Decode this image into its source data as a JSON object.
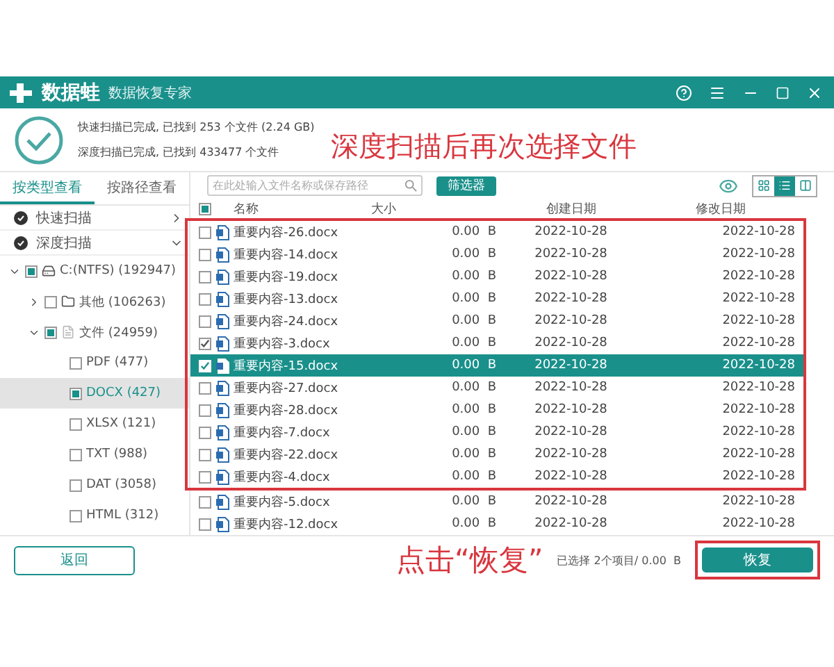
{
  "app": {
    "name": "数据蛙",
    "subtitle": "数据恢复专家"
  },
  "scan_status": [
    "快速扫描已完成, 已找到 253 个文件 (2.24 GB)",
    "深度扫描已完成, 已找到 433477 个文件"
  ],
  "annotations": [
    "深度扫描后再次选择文件",
    "点击“恢复”"
  ],
  "view_tabs": [
    {
      "label": "按类型查看",
      "selected": true
    },
    {
      "label": "按路径查看",
      "selected": false
    }
  ],
  "scan_modes": [
    {
      "label": "快速扫描",
      "expanded": false
    },
    {
      "label": "深度扫描",
      "expanded": true
    }
  ],
  "tree": [
    {
      "label": "C:(NTFS) (192947)",
      "kind": "drive",
      "checked": true,
      "partial": true,
      "expanded": true,
      "selected": false,
      "children": [
        {
          "label": "其他 (106263)",
          "kind": "folder",
          "checked": false,
          "partial": false,
          "expanded": false,
          "selected": false
        },
        {
          "label": "文件 (24959)",
          "kind": "category",
          "checked": true,
          "partial": true,
          "expanded": true,
          "selected": false,
          "children": [
            {
              "label": "PDF (477)",
              "kind": "type",
              "checked": false,
              "partial": false,
              "selected": false
            },
            {
              "label": "DOCX (427)",
              "kind": "type",
              "checked": true,
              "partial": true,
              "selected": true
            },
            {
              "label": "XLSX (121)",
              "kind": "type",
              "checked": false,
              "partial": false,
              "selected": false
            },
            {
              "label": "TXT (988)",
              "kind": "type",
              "checked": false,
              "partial": false,
              "selected": false
            },
            {
              "label": "DAT (3058)",
              "kind": "type",
              "checked": false,
              "partial": false,
              "selected": false
            },
            {
              "label": "HTML (312)",
              "kind": "type",
              "checked": false,
              "partial": false,
              "selected": false
            }
          ]
        }
      ]
    }
  ],
  "search": {
    "placeholder": "在此处输入文件名称或保存路径"
  },
  "filter_button": "筛选器",
  "view_modes": [
    {
      "kind": "grid",
      "selected": false
    },
    {
      "kind": "list",
      "selected": true
    },
    {
      "kind": "detail",
      "selected": false
    }
  ],
  "table": {
    "header_checked": true,
    "header_partial": true,
    "columns": [
      "名称",
      "大小",
      "创建日期",
      "修改日期"
    ],
    "framed_rows": [
      {
        "name": "重要内容-26.docx",
        "size": "0.00  B",
        "created": "2022-10-28",
        "modified": "2022-10-28",
        "checked": false,
        "selected": false
      },
      {
        "name": "重要内容-14.docx",
        "size": "0.00  B",
        "created": "2022-10-28",
        "modified": "2022-10-28",
        "checked": false,
        "selected": false
      },
      {
        "name": "重要内容-19.docx",
        "size": "0.00  B",
        "created": "2022-10-28",
        "modified": "2022-10-28",
        "checked": false,
        "selected": false
      },
      {
        "name": "重要内容-13.docx",
        "size": "0.00  B",
        "created": "2022-10-28",
        "modified": "2022-10-28",
        "checked": false,
        "selected": false
      },
      {
        "name": "重要内容-24.docx",
        "size": "0.00  B",
        "created": "2022-10-28",
        "modified": "2022-10-28",
        "checked": false,
        "selected": false
      },
      {
        "name": "重要内容-3.docx",
        "size": "0.00  B",
        "created": "2022-10-28",
        "modified": "2022-10-28",
        "checked": true,
        "selected": false
      },
      {
        "name": "重要内容-15.docx",
        "size": "0.00  B",
        "created": "2022-10-28",
        "modified": "2022-10-28",
        "checked": true,
        "selected": true
      },
      {
        "name": "重要内容-27.docx",
        "size": "0.00  B",
        "created": "2022-10-28",
        "modified": "2022-10-28",
        "checked": false,
        "selected": false
      },
      {
        "name": "重要内容-28.docx",
        "size": "0.00  B",
        "created": "2022-10-28",
        "modified": "2022-10-28",
        "checked": false,
        "selected": false
      },
      {
        "name": "重要内容-7.docx",
        "size": "0.00  B",
        "created": "2022-10-28",
        "modified": "2022-10-28",
        "checked": false,
        "selected": false
      },
      {
        "name": "重要内容-22.docx",
        "size": "0.00  B",
        "created": "2022-10-28",
        "modified": "2022-10-28",
        "checked": false,
        "selected": false
      },
      {
        "name": "重要内容-4.docx",
        "size": "0.00  B",
        "created": "2022-10-28",
        "modified": "2022-10-28",
        "checked": false,
        "selected": false
      }
    ],
    "rows": [
      {
        "name": "重要内容-5.docx",
        "size": "0.00  B",
        "created": "2022-10-28",
        "modified": "2022-10-28",
        "checked": false,
        "selected": false
      },
      {
        "name": "重要内容-12.docx",
        "size": "0.00  B",
        "created": "2022-10-28",
        "modified": "2022-10-28",
        "checked": false,
        "selected": false
      }
    ]
  },
  "footer": {
    "back_button": "返回",
    "selection_summary": "已选择 2个项目/ 0.00  B",
    "recover_button": "恢复"
  }
}
